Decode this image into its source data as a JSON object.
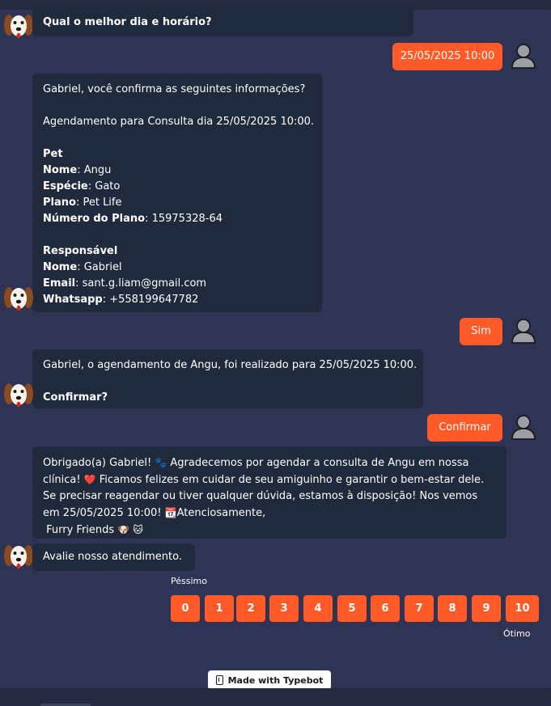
{
  "messages": {
    "q_date": "Qual o melhor dia e horário?",
    "user_date": "25/05/2025 10:00",
    "confirm_intro": "Gabriel, você confirma as seguintes informações?",
    "confirm_appointment": "Agendamento para Consulta dia 25/05/2025 10:00.",
    "pet_heading": "Pet",
    "pet_name_label": "Nome",
    "pet_name_value": ": Angu",
    "species_label": "Espécie",
    "species_value": ": Gato",
    "plan_label": "Plano",
    "plan_value": ": Pet Life",
    "plan_number_label": "Número do Plano",
    "plan_number_value": ": 15975328-64",
    "owner_heading": "Responsável",
    "owner_name_label": "Nome",
    "owner_name_value": ": Gabriel",
    "email_label": "Email",
    "email_value": ": sant.g.liam@gmail.com",
    "whatsapp_label": "Whatsapp",
    "whatsapp_value": ": +558199647782",
    "user_yes": "Sim",
    "done_text": "Gabriel, o agendamento de Angu, foi realizado para 25/05/2025 10:00.",
    "confirm_question": "Confirmar?",
    "user_confirm": "Confirmar",
    "thanks_1": "Obrigado(a) Gabriel! ",
    "thanks_1b": " Agradecemos por agendar a consulta de Angu em nossa",
    "thanks_2a": "clínica! ",
    "thanks_2b": " Ficamos felizes em cuidar de seu amiguinho e garantir o bem-estar dele.",
    "thanks_3": "Se precisar reagendar ou tiver qualquer dúvida, estamos à disposição! Nos vemos",
    "thanks_4a": "em 25/05/2025 10:00! ",
    "thanks_4b": "Atenciosamente,",
    "thanks_5": " Furry Friends ",
    "rate_prompt": "Avalie nosso atendimento."
  },
  "icons": {
    "paw": "🐾",
    "heart": "❤️",
    "calendar": "📆",
    "dog": "🐶",
    "cat": "🐱"
  },
  "rating": {
    "min_label": "Péssimo",
    "max_label": "Ótimo",
    "options": [
      "0",
      "1",
      "2",
      "3",
      "4",
      "5",
      "6",
      "7",
      "8",
      "9",
      "10"
    ]
  },
  "branding": {
    "badge": "Made with Typebot"
  },
  "colors": {
    "background": "#2f3354",
    "bot_bubble": "#1f2a3c",
    "accent": "#ff5a27"
  }
}
